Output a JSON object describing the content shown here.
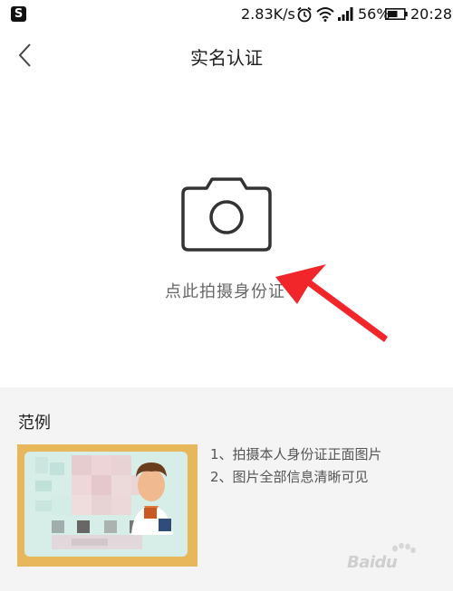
{
  "status_bar": {
    "app_icon_letter": "S",
    "net_speed": "2.83K/s",
    "battery_percent": "56%",
    "time": "20:28",
    "icons": [
      "alarm-icon",
      "wifi-icon",
      "signal-icon",
      "battery-icon"
    ]
  },
  "nav": {
    "title": "实名认证",
    "back_icon": "chevron-left-icon"
  },
  "capture": {
    "icon": "camera-icon",
    "label": "点此拍摄身份证"
  },
  "example": {
    "title": "范例",
    "tips": [
      "1、拍摄本人身份证正面图片",
      "2、图片全部信息清晰可见"
    ]
  },
  "watermark": {
    "text": "Baidu"
  },
  "colors": {
    "accent_arrow": "#f0262a",
    "background": "#f4f4f4",
    "card_border": "#e8b75c"
  }
}
